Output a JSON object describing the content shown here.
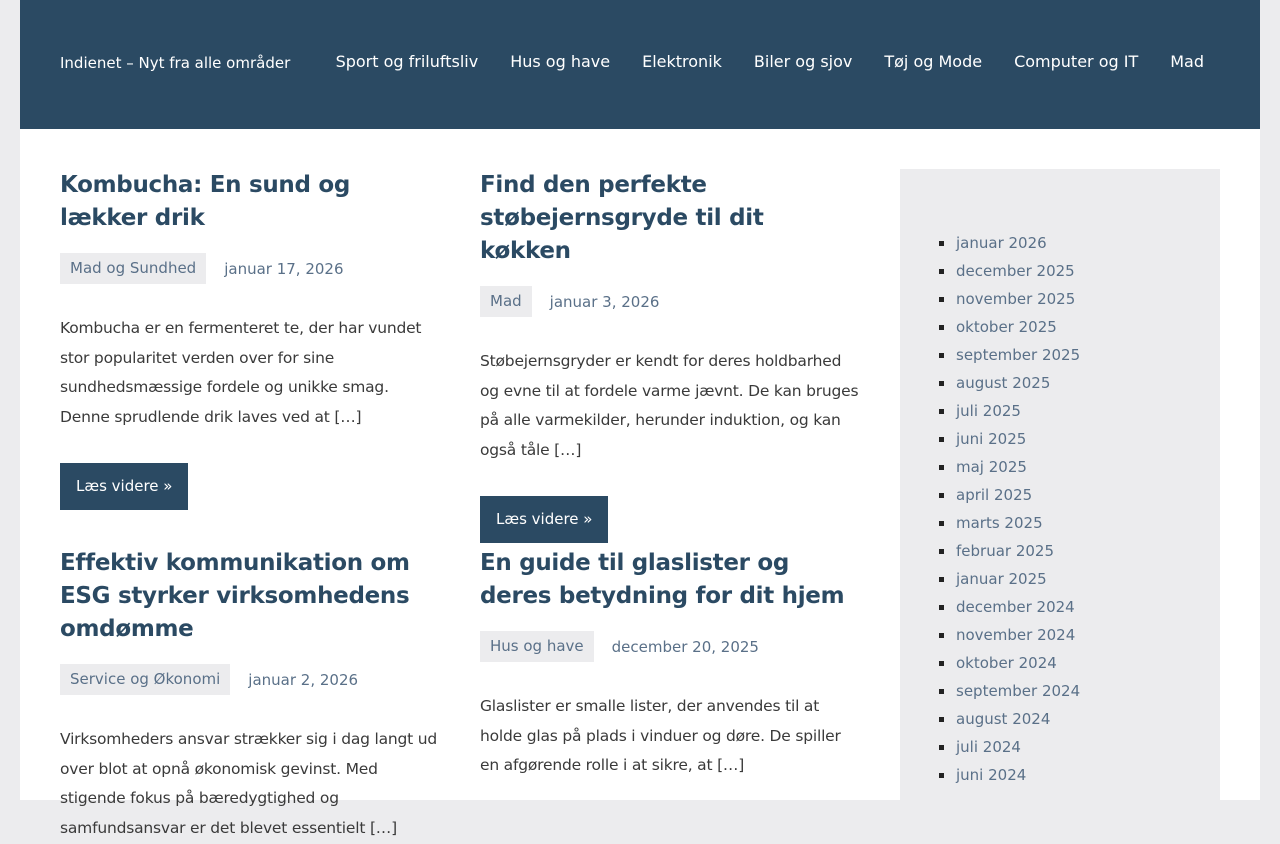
{
  "site": {
    "title": "Indienet – Nyt fra alle områder"
  },
  "nav": {
    "items": [
      "Sport og friluftsliv",
      "Hus og have",
      "Elektronik",
      "Biler og sjov",
      "Tøj og Mode",
      "Computer og IT",
      "Mad"
    ]
  },
  "posts": [
    {
      "title": "Kombucha: En sund og lækker drik",
      "category": "Mad og Sundhed",
      "date": "januar 17, 2026",
      "excerpt": "Kombucha er en fermenteret te, der har vundet stor popularitet verden over for sine sundhedsmæssige fordele og unikke smag. Denne sprudlende drik laves ved at […]",
      "more": "Læs videre »"
    },
    {
      "title": "Find den perfekte støbejernsgryde til dit køkken",
      "category": "Mad",
      "date": "januar 3, 2026",
      "excerpt": "Støbejernsgryder er kendt for deres holdbarhed og evne til at fordele varme jævnt. De kan bruges på alle varmekilder, herunder induktion, og kan også tåle […]",
      "more": "Læs videre »"
    },
    {
      "title": "Effektiv kommunikation om ESG styrker virksomhedens omdømme",
      "category": "Service og Økonomi",
      "date": "januar 2, 2026",
      "excerpt": "Virksomheders ansvar strækker sig i dag langt ud over blot at opnå økonomisk gevinst. Med stigende fokus på bæredygtighed og samfundsansvar er det blevet essentielt […]"
    },
    {
      "title": "En guide til glaslister og deres betydning for dit hjem",
      "category": "Hus og have",
      "date": "december 20, 2025",
      "excerpt": "Glaslister er smalle lister, der anvendes til at holde glas på plads i vinduer og døre. De spiller en afgørende rolle i at sikre, at […]"
    }
  ],
  "sidebar": {
    "archives": [
      "januar 2026",
      "december 2025",
      "november 2025",
      "oktober 2025",
      "september 2025",
      "august 2025",
      "juli 2025",
      "juni 2025",
      "maj 2025",
      "april 2025",
      "marts 2025",
      "februar 2025",
      "januar 2025",
      "december 2024",
      "november 2024",
      "oktober 2024",
      "september 2024",
      "august 2024",
      "juli 2024",
      "juni 2024"
    ]
  }
}
